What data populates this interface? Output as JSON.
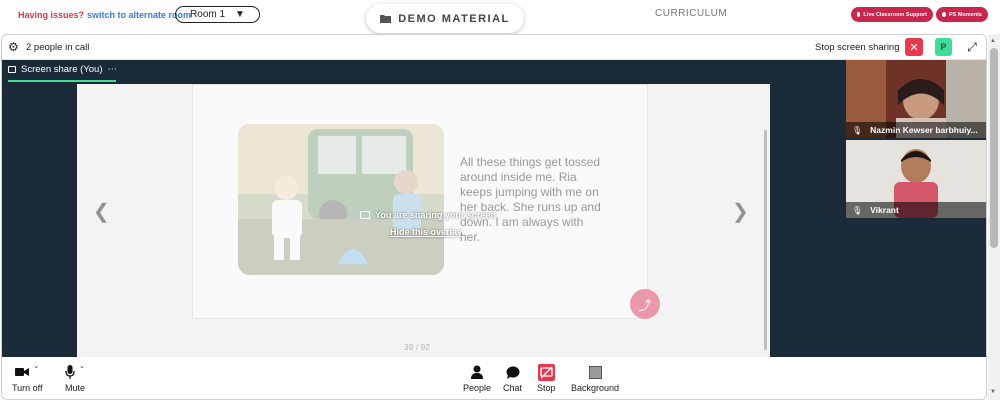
{
  "header": {
    "issues_label": "Having issues?",
    "alternate_room_link": "switch to alternate room",
    "room_selector": "Room 1",
    "demo_material_label": "DEMO MATERIAL",
    "curriculum_label": "CURRICULUM",
    "live_support_label": "Live Classroom Support",
    "ps_moments_label": "PS Moments"
  },
  "call": {
    "people_count": "2 people in call",
    "stop_share_label": "Stop screen sharing",
    "participant_initial": "P",
    "tab_label": "Screen share (You)",
    "tab_menu": "⋯"
  },
  "shared_content": {
    "book_text": "All these things get tossed around inside me. Ria keeps jumping with me on her back. She runs up and down. I am always with her.",
    "page_indicator": "39 / 92",
    "overlay_message": "You are sharing your screen",
    "hide_overlay_link": "Hide this overlay"
  },
  "participants": [
    {
      "name": "Nazmin Kewser barbhuiy..."
    },
    {
      "name": "Vikrant"
    }
  ],
  "controls": {
    "turn_off_label": "Turn off",
    "mute_label": "Mute",
    "people_label": "People",
    "chat_label": "Chat",
    "stop_label": "Stop",
    "background_label": "Background"
  },
  "colors": {
    "accent_red": "#e53950",
    "accent_green": "#3ddc97",
    "stage_bg": "#1b2a38",
    "pill_bg": "#c8264a"
  },
  "icons": [
    "gear-icon",
    "close-icon",
    "expand-icon",
    "screen-share-icon",
    "camera-icon",
    "mic-icon",
    "person-icon",
    "chat-icon",
    "stop-share-icon",
    "background-icon",
    "share-icon",
    "chevron-left-icon",
    "chevron-right-icon",
    "folder-icon"
  ]
}
